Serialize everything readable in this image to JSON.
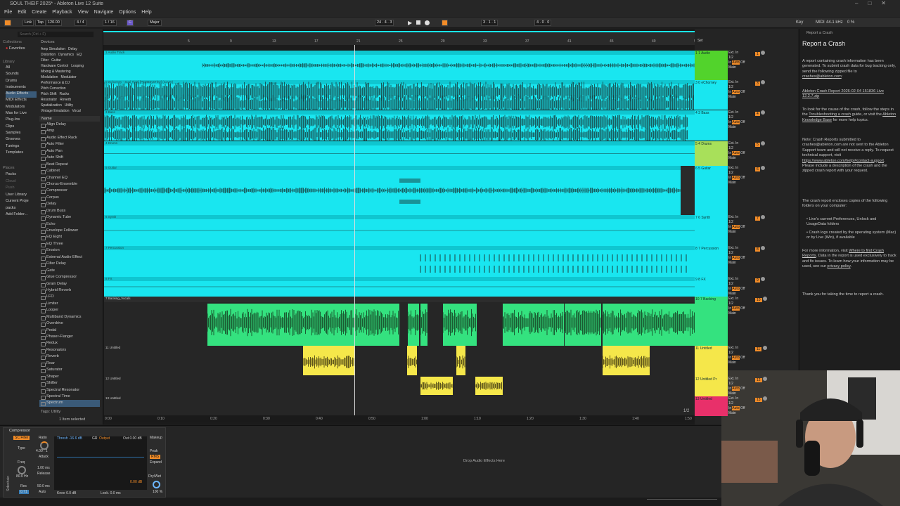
{
  "window": {
    "title": "SOUL THEIF 2025* - Ableton Live 12 Suite"
  },
  "menu": [
    "File",
    "Edit",
    "Create",
    "Playback",
    "View",
    "Navigate",
    "Options",
    "Help"
  ],
  "control_bar": {
    "link": "Link",
    "tap": "Tap",
    "tempo": "120.00",
    "time_sig": "4 / 4",
    "quantize": "1 / 16",
    "key": "C",
    "scale": "Major",
    "position": "24 . 4 . 3",
    "loop_start": "3 . 1 . 1",
    "loop_length": "4 . 0 . 0",
    "key_label": "Key",
    "midi_label": "MIDI",
    "sample_rate": "44.1 kHz",
    "cpu": "0 %"
  },
  "browser": {
    "search_placeholder": "Search (Ctrl + F)",
    "collections_header": "Collections",
    "collections": [
      "Favorites"
    ],
    "library_header": "Library",
    "library": [
      "All",
      "Sounds",
      "Drums",
      "Instruments",
      "Audio Effects",
      "MIDI Effects",
      "Modulators",
      "Max for Live",
      "Plug-Ins",
      "Clips",
      "Samples",
      "Grooves",
      "Tunings",
      "Templates"
    ],
    "places_header": "Places",
    "places": [
      "Packs",
      "Cloud",
      "Push",
      "User Library",
      "Current Proje",
      "packs",
      "Add Folder..."
    ],
    "devices_header": "Devices",
    "device_tags": [
      "Amp Simulation",
      "Delay",
      "Distortion",
      "Dynamics",
      "EQ",
      "Filter",
      "Guitar",
      "Hardware Control",
      "Looping",
      "Mixing & Mastering",
      "Modulation",
      "Modulator",
      "Performance & DJ",
      "Pitch Correction",
      "Pitch Shift",
      "Racks",
      "Resonator",
      "Reverb",
      "Spatialization",
      "Utility",
      "Vintage Emulation",
      "Vocal"
    ],
    "name_header": "Name",
    "devices": [
      "Align Delay",
      "Amp",
      "Audio Effect Rack",
      "Auto Filter",
      "Auto Pan",
      "Auto Shift",
      "Beat Repeat",
      "Cabinet",
      "Channel EQ",
      "Chorus-Ensemble",
      "Compressor",
      "Corpus",
      "Delay",
      "Drum Buss",
      "Dynamic Tube",
      "Echo",
      "Envelope Follower",
      "EQ Eight",
      "EQ Three",
      "Erosion",
      "External Audio Effect",
      "Filter Delay",
      "Gate",
      "Glue Compressor",
      "Grain Delay",
      "Hybrid Reverb",
      "LFO",
      "Limiter",
      "Looper",
      "Multiband Dynamics",
      "Overdrive",
      "Pedal",
      "Phaser-Flanger",
      "Redux",
      "Resonators",
      "Reverb",
      "Roar",
      "Saturator",
      "Shaper",
      "Shifter",
      "Spectral Resonator",
      "Spectral Time",
      "Spectrum"
    ],
    "tags_label": "Tags: Utility",
    "footer": "1 Item selected"
  },
  "tracks": [
    {
      "name": "1 Audio Track",
      "mixer_name": "1 1 Audio",
      "num": "1"
    },
    {
      "name": "0 eChorney - Soul Thief [PEMB6y6ThQ] (Cover)",
      "mixer_name": "3 0 eChorney",
      "num": "3"
    },
    {
      "name": "3 Bass",
      "mixer_name": "4 3 Bass",
      "num": "4"
    },
    {
      "name": "4 Drums",
      "mixer_name": "5 4 Drums",
      "num": "5"
    },
    {
      "name": "5 Guitar",
      "mixer_name": "6 5 Guitar",
      "num": "6"
    },
    {
      "name": "6 Synth",
      "mixer_name": "7 6 Synth",
      "num": "7"
    },
    {
      "name": "7 Percussion",
      "mixer_name": "8 7 Percussion",
      "num": "8"
    },
    {
      "name": "8 FX",
      "mixer_name": "9 8 FX",
      "num": "9"
    },
    {
      "name": "7 Backing_Vocals",
      "mixer_name": "10 7 Backing",
      "num": "10"
    },
    {
      "name": "11 Untitled",
      "mixer_name": "11 Untitled",
      "num": "11"
    },
    {
      "name": "12 Untitled",
      "mixer_name": "12 Untitled Pr",
      "num": "12"
    },
    {
      "name": "13 Untitled",
      "mixer_name": "13 Untitled",
      "num": "13"
    }
  ],
  "mixer": {
    "input": "Ext. In",
    "channel": "1/2",
    "monitor": [
      "In",
      "Auto",
      "Off"
    ],
    "out": "Main",
    "set_label": "Set"
  },
  "clips": {
    "vocal_clip": "UntitledProj",
    "untitled_clip": "Untitled Project(1)",
    "untitled_small": "Untitled Project"
  },
  "timeline_labels": [
    "0:00",
    "0:10",
    "0:20",
    "0:30",
    "0:40",
    "0:50",
    "1:00",
    "1:10",
    "1:20",
    "1:30",
    "1:40",
    "1:50"
  ],
  "bar_numbers": [
    "5",
    "9",
    "13",
    "17",
    "21",
    "25",
    "29",
    "33",
    "37",
    "41",
    "45",
    "49",
    "53",
    "57"
  ],
  "page_indicator": "1/2",
  "crash_panel": {
    "header": "Report a Crash",
    "title": "Report a Crash",
    "p1": "A report containing crash information has been generated. To submit crash data for bug tracking only, send the following zipped file to",
    "p1_link": "crashes@ableton.com",
    "file": "Ableton Crash Report 2026-02-04 151836 Live 12.2.7.zip",
    "p2a": "To look for the cause of the crash, follow the steps in the",
    "p2_link1": "Troubleshooting a crash",
    "p2b": "guide, or visit the",
    "p2_link2": "Ableton Knowledge Base",
    "p2c": "for more help topics.",
    "p3": "Note: Crash Reports submitted to crashes@ableton.com are not sent to the Ableton Support team and will not receive a reply. To request technical support, visit",
    "p3_link": "https://www.ableton.com/help/#contact-support",
    "p3b": ". Please include a description of the crash and the zipped crash report with your request.",
    "p4": "The crash report encloses copies of the following folders on your computer:",
    "b1": "Live's current Preferences, Unlock and UsageData folders",
    "b2": "Crash logs created by the operating system (Mac) or by Live (Win), if available",
    "p5a": "For more information, visit",
    "p5_link": "Where to find Crash Reports",
    "p5b": ". Data in the report is used exclusively to track and fix issues. To learn how your information may be used, see our",
    "p5_link2": "privacy policy",
    "p6": "Thank you for taking the time to report a crash."
  },
  "detail": {
    "device_name": "Compressor",
    "sc_filter": "SC Filter",
    "ratio_label": "Ratio",
    "ratio": "4.00 : 1",
    "attack_label": "Attack",
    "attack": "1.00 ms",
    "release_label": "Release",
    "release": "50.0 ms",
    "freq_label": "Freq",
    "freq": "80.0 Hz",
    "res_label": "Res",
    "res": "0.71",
    "type_label": "Type",
    "threshold": "Thresh -16.6 dB",
    "gr": "GR",
    "output_label": "Output",
    "out": "Out 0.00 dB",
    "makeup": "Makeup",
    "peak": "Peak",
    "rms": "RMS",
    "expand": "Expand",
    "auto": "Auto",
    "knee": "Knee 6.0 dB",
    "lookahead": "Look. 0.0 ms",
    "dry_wet_label": "Dry/Wet",
    "dry_wet": "100 %",
    "db_readout": "0.00 dB",
    "sidechain_label": "Sidechain",
    "drop_hint": "Drop Audio Effects Here"
  },
  "colors": {
    "cyan": "#19e6f0",
    "green": "#34e27f",
    "yellow": "#f5e74a",
    "orange": "#f28c28",
    "lime": "#52d32c"
  }
}
